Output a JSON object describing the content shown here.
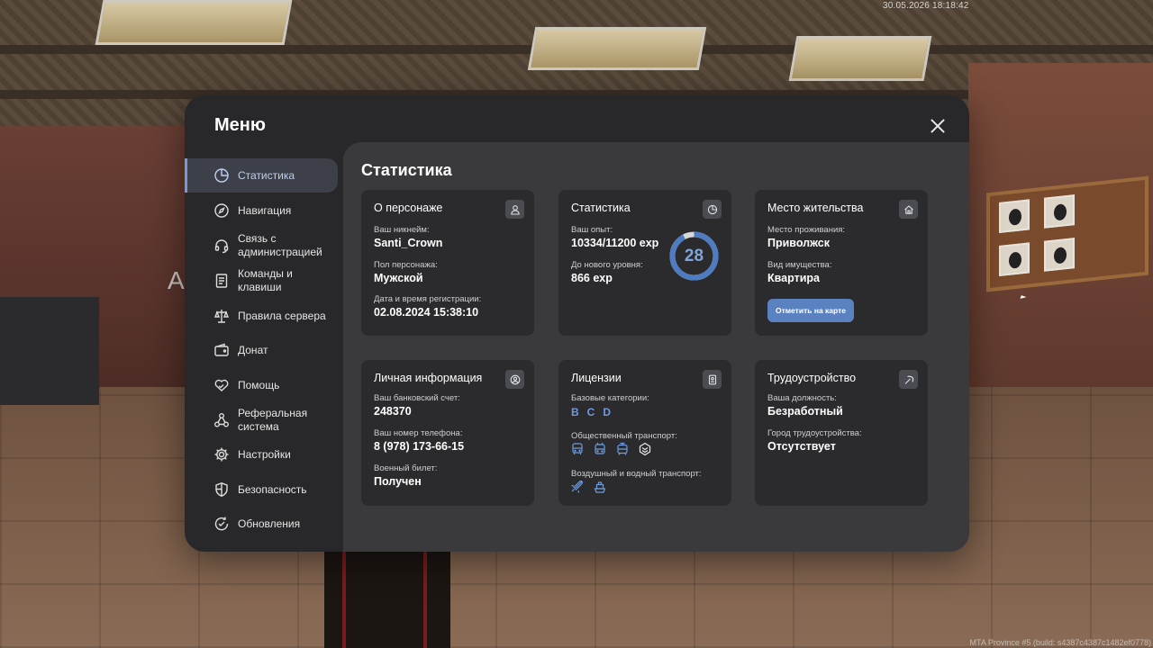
{
  "overlay": {
    "timestamp": "30.05.2026 18:18:42",
    "build": "MTA Province #5 (build: s4387c4387c1482ef0778)",
    "ghost_letter": "A"
  },
  "menu": {
    "title": "Меню",
    "close_icon": "close-icon"
  },
  "sidebar": {
    "items": [
      {
        "label": "Статистика",
        "icon": "pie-chart-icon",
        "active": true
      },
      {
        "label": "Навигация",
        "icon": "compass-icon"
      },
      {
        "label": "Связь с администрацией",
        "icon": "headset-icon"
      },
      {
        "label": "Команды и клавиши",
        "icon": "document-icon"
      },
      {
        "label": "Правила сервера",
        "icon": "scales-icon"
      },
      {
        "label": "Донат",
        "icon": "wallet-icon"
      },
      {
        "label": "Помощь",
        "icon": "heart-hand-icon"
      },
      {
        "label": "Реферальная система",
        "icon": "network-icon"
      },
      {
        "label": "Настройки",
        "icon": "gear-icon"
      },
      {
        "label": "Безопасность",
        "icon": "shield-icon"
      },
      {
        "label": "Обновления",
        "icon": "refresh-check-icon"
      }
    ]
  },
  "content": {
    "title": "Статистика",
    "cards": {
      "character": {
        "title": "О персонаже",
        "icon": "user-icon",
        "nickname_label": "Ваш никнейм:",
        "nickname": "Santi_Crown",
        "gender_label": "Пол персонажа:",
        "gender": "Мужской",
        "reg_label": "Дата и время регистрации:",
        "reg_value": "02.08.2024 15:38:10"
      },
      "stats": {
        "title": "Статистика",
        "icon": "pie-chart-icon",
        "exp_label": "Ваш опыт:",
        "exp_value": "10334/11200 exp",
        "next_label": "До нового уровня:",
        "next_value": "866 exp",
        "level": "28",
        "progress": 0.9227,
        "ring_color": "#4f7bc0",
        "ring_track": "#d9d9d9"
      },
      "residence": {
        "title": "Место жительства",
        "icon": "home-icon",
        "place_label": "Место проживания:",
        "place": "Приволжск",
        "property_label": "Вид имущества:",
        "property": "Квартира",
        "map_button": "Отметить на карте"
      },
      "personal": {
        "title": "Личная информация",
        "icon": "user-circle-icon",
        "bank_label": "Ваш банковский счет:",
        "bank": "248370",
        "phone_label": "Ваш номер телефона:",
        "phone": "8 (978) 173-66-15",
        "military_label": "Военный билет:",
        "military": "Получен"
      },
      "licenses": {
        "title": "Лицензии",
        "icon": "id-card-icon",
        "base_label": "Базовые категории:",
        "categories": [
          "B",
          "C",
          "D"
        ],
        "public_label": "Общественный транспорт:",
        "public_icons": [
          "bus-icon",
          "trolleybus-icon",
          "tram-icon",
          "badge-icon"
        ],
        "air_label": "Воздушный и водный транспорт:",
        "air_icons": [
          "plane-icon",
          "boat-icon"
        ]
      },
      "employment": {
        "title": "Трудоустройство",
        "icon": "pickaxe-icon",
        "position_label": "Ваша должность:",
        "position": "Безработный",
        "city_label": "Город трудоустройства:",
        "city": "Отсутствует"
      }
    }
  },
  "colors": {
    "accent": "#6f9be0",
    "button": "#5b82c0",
    "panel": "#28282a",
    "content": "#3a3a3c",
    "card": "#2b2b2d"
  }
}
